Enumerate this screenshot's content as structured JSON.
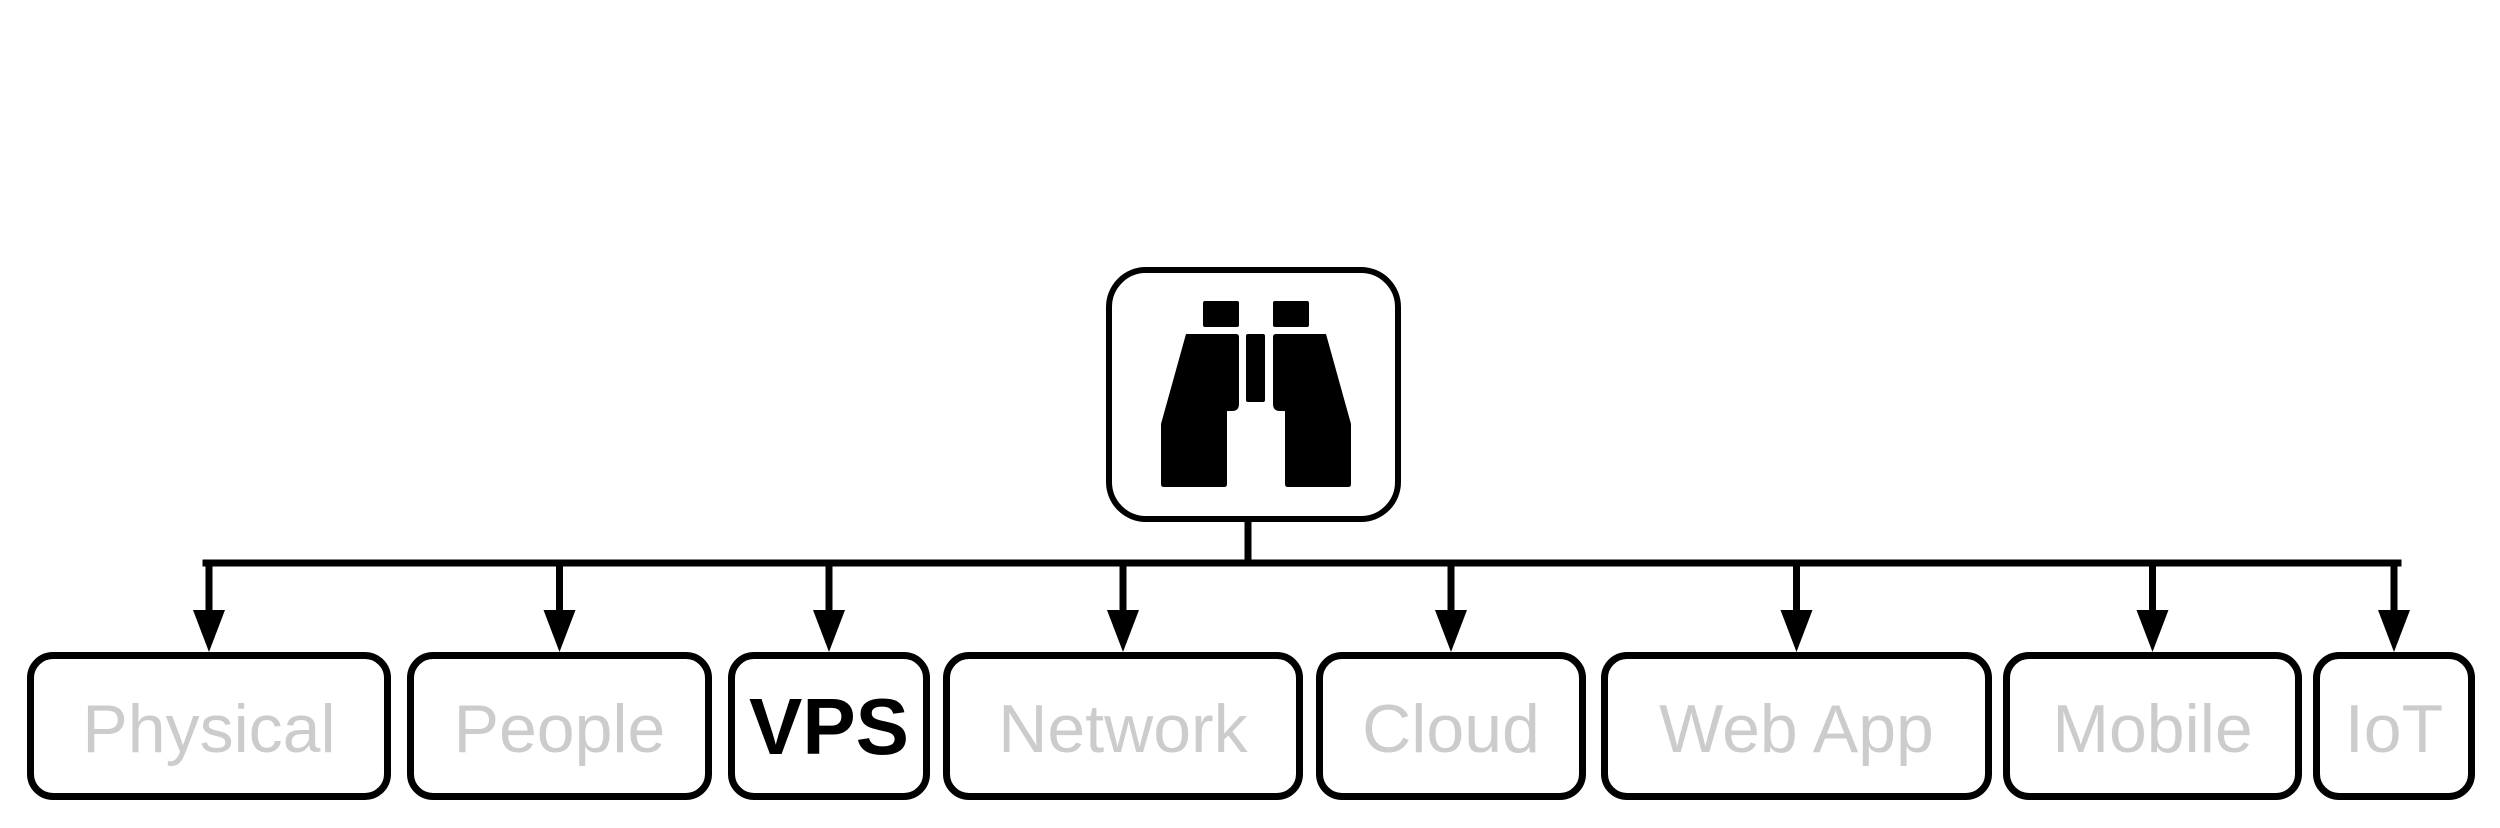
{
  "diagram": {
    "root": {
      "icon": "binoculars-icon",
      "label": ""
    },
    "categories": [
      {
        "label": "Physical",
        "active": false
      },
      {
        "label": "People",
        "active": false
      },
      {
        "label": "VPS",
        "active": true
      },
      {
        "label": "Network",
        "active": false
      },
      {
        "label": "Cloud",
        "active": false
      },
      {
        "label": "Web App",
        "active": false
      },
      {
        "label": "Mobile",
        "active": false
      },
      {
        "label": "IoT",
        "active": false
      }
    ],
    "colors": {
      "stroke": "#000000",
      "active_text": "#000000",
      "inactive_text": "#cccccc",
      "background": "#ffffff"
    }
  }
}
